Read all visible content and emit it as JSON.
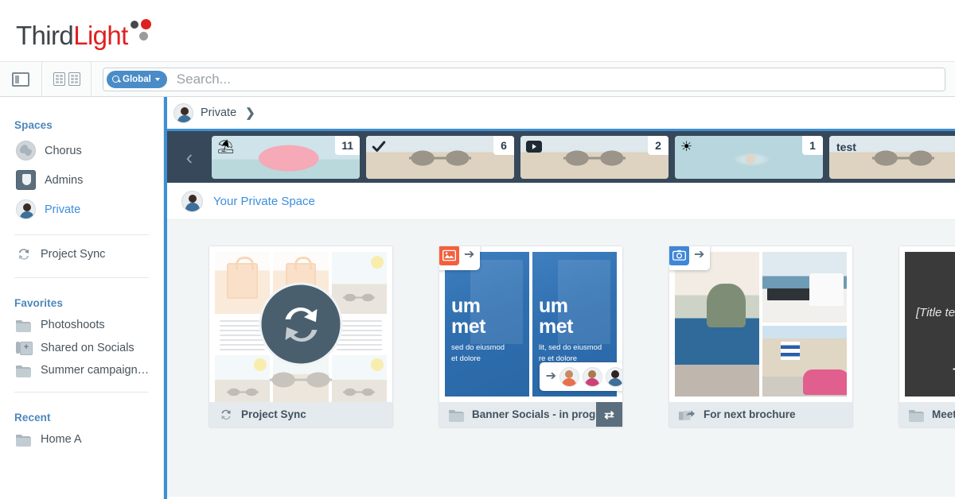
{
  "brand": {
    "name_part1": "Third",
    "name_part2": "Light"
  },
  "toolbar": {
    "panel_toggle": "panel-toggle",
    "grid_toggle": "grid-toggle",
    "search_scope": "Global",
    "search_placeholder": "Search...",
    "search_value": ""
  },
  "sidebar": {
    "sections": [
      {
        "heading": "Spaces",
        "items": [
          {
            "label": "Chorus",
            "icon": "globe-icon",
            "active": false
          },
          {
            "label": "Admins",
            "icon": "shield-icon",
            "active": false
          },
          {
            "label": "Private",
            "icon": "avatar-icon",
            "active": true
          }
        ]
      },
      {
        "heading": "",
        "items": [
          {
            "label": "Project Sync",
            "icon": "sync-icon",
            "active": false
          }
        ]
      },
      {
        "heading": "Favorites",
        "items": [
          {
            "label": "Photoshoots",
            "icon": "folder-icon",
            "active": false
          },
          {
            "label": "Shared on Socials",
            "icon": "stack-icon",
            "active": false
          },
          {
            "label": "Summer campaign…",
            "icon": "folder-icon",
            "active": false
          }
        ]
      },
      {
        "heading": "Recent",
        "items": [
          {
            "label": "Home A",
            "icon": "folder-icon",
            "active": false
          }
        ]
      }
    ]
  },
  "breadcrumb": {
    "label": "Private",
    "separator": "❯"
  },
  "tabstrip": {
    "scroll_left": "‹",
    "tabs": [
      {
        "count": "11",
        "overlay": "⛱",
        "title": "",
        "thumb": "beach-float"
      },
      {
        "count": "6",
        "overlay": "check",
        "title": "",
        "thumb": "sunglasses"
      },
      {
        "count": "2",
        "overlay": "video",
        "title": "",
        "thumb": "sunglasses"
      },
      {
        "count": "1",
        "overlay": "☀",
        "title": "",
        "thumb": "water"
      },
      {
        "count": "",
        "overlay": "",
        "title": "test",
        "thumb": "sunglasses"
      }
    ]
  },
  "space_header": {
    "title": "Your Private Space"
  },
  "cards": [
    {
      "label": "Project Sync",
      "icon": "sync-icon",
      "has_swap_button": false,
      "badge": null
    },
    {
      "label": "Banner Socials - in progress",
      "icon": "folder-icon",
      "has_swap_button": true,
      "swap_symbol": "⇄",
      "badge": {
        "kind": "artwork-upload-badge",
        "color": "#f4603d",
        "arrow": "➔"
      },
      "people_badge": {
        "arrow": "➔",
        "avatars": [
          "person-orange",
          "person-pink",
          "person-blue"
        ]
      },
      "banner_text": {
        "left": {
          "line1": "um",
          "line2": "met",
          "sub1": "sed do eiusmod",
          "sub2": "et dolore"
        },
        "right": {
          "line1": "um",
          "line2": "met",
          "sub1": "lit, sed do eiusmod",
          "sub2": "re et dolore"
        }
      }
    },
    {
      "label": "For next brochure",
      "icon": "share-out-icon",
      "has_swap_button": false,
      "badge": {
        "kind": "camera-upload-badge",
        "color": "#3f86d8",
        "arrow": "➔"
      }
    },
    {
      "label": "Meeting",
      "icon": "folder-icon",
      "has_swap_button": false,
      "badge": null,
      "slide_text": {
        "line1": "[Title text]",
        "line2": "T"
      }
    }
  ],
  "colors": {
    "accent_blue": "#3d8fd4",
    "link_blue": "#3b8ede",
    "heading_blue": "#4d87bb",
    "tabstrip_dark": "#36485a",
    "content_bg": "#f2f5f6",
    "brand_red": "#e02020"
  }
}
